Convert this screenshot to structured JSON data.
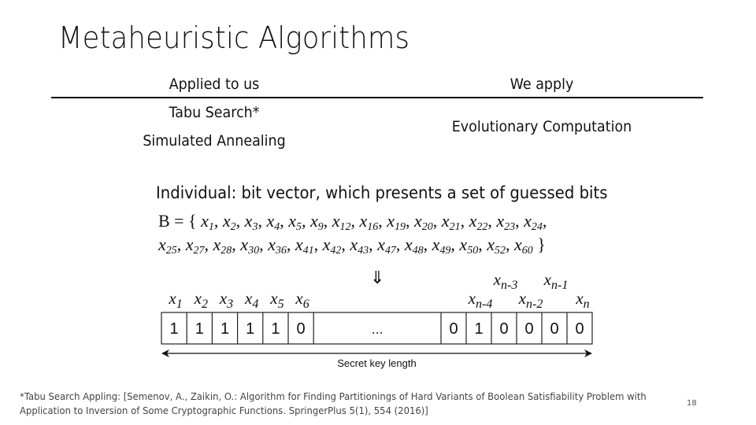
{
  "slide": {
    "title": "Metaheuristic Algorithms",
    "slide_number": "18"
  },
  "comparison": {
    "headers": [
      "Applied to us",
      "We apply"
    ],
    "left_items": [
      "Tabu Search*",
      "Simulated Annealing"
    ],
    "right_items": [
      "Evolutionary Computation"
    ]
  },
  "individual": {
    "text": "Individual: bit vector, which presents a set of guessed bits",
    "set_name": "B",
    "set_indices_line1": [
      "1",
      "2",
      "3",
      "4",
      "5",
      "9",
      "12",
      "16",
      "19",
      "20",
      "21",
      "22",
      "23",
      "24"
    ],
    "set_indices_line2": [
      "25",
      "27",
      "28",
      "30",
      "36",
      "41",
      "42",
      "43",
      "47",
      "48",
      "49",
      "50",
      "52",
      "60"
    ],
    "implies_symbol": "⇓"
  },
  "diagram": {
    "left_labels": [
      {
        "var": "x",
        "sub": "1"
      },
      {
        "var": "x",
        "sub": "2"
      },
      {
        "var": "x",
        "sub": "3"
      },
      {
        "var": "x",
        "sub": "4"
      },
      {
        "var": "x",
        "sub": "5"
      },
      {
        "var": "x",
        "sub": "6"
      }
    ],
    "left_bits": [
      "1",
      "1",
      "1",
      "1",
      "1",
      "0"
    ],
    "ellipsis": "...",
    "right_bits": [
      "0",
      "1",
      "0",
      "0",
      "0",
      "0"
    ],
    "right_labels": [
      {
        "var": "x",
        "sub": "n-4",
        "row": "low"
      },
      {
        "var": "x",
        "sub": "n-3",
        "row": "high"
      },
      {
        "var": "x",
        "sub": "n-2",
        "row": "low"
      },
      {
        "var": "x",
        "sub": "n-1",
        "row": "high"
      },
      {
        "var": "x",
        "sub": "n",
        "row": "low"
      }
    ],
    "length_label": "Secret key length"
  },
  "footnote": {
    "line1": "*Tabu Search Appling: [Semenov, A., Zaikin, O.: Algorithm for Finding Partitionings of Hard Variants of Boolean Satisfiability Problem with",
    "line2": "Application to Inversion of Some Cryptographic Functions. SpringerPlus 5(1), 554 (2016)]"
  }
}
